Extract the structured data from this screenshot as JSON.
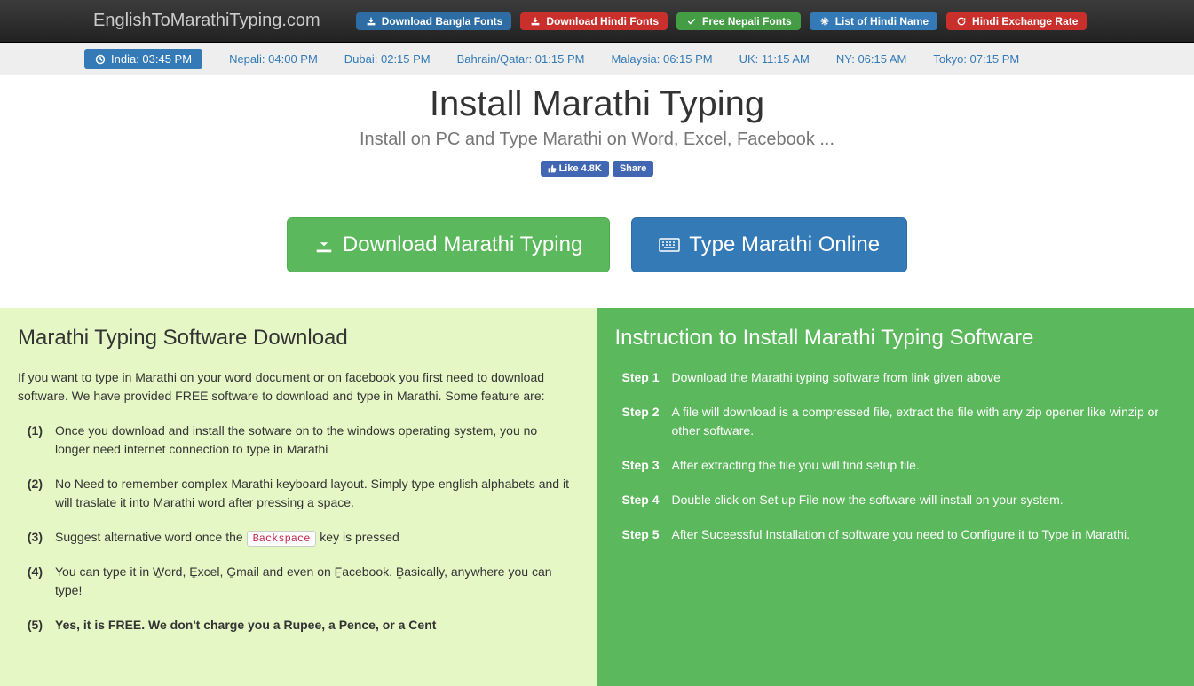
{
  "header": {
    "brand": "EnglishToMarathiTyping.com",
    "links": [
      {
        "label": "Download Bangla Fonts",
        "class": "pill-blue",
        "icon": "download"
      },
      {
        "label": "Download Hindi Fonts",
        "class": "pill-red",
        "icon": "download"
      },
      {
        "label": "Free Nepali Fonts",
        "class": "pill-green",
        "icon": "check"
      },
      {
        "label": "List of Hindi Name",
        "class": "pill-teal",
        "icon": "asterisk"
      },
      {
        "label": "Hindi Exchange Rate",
        "class": "pill-red",
        "icon": "refresh"
      }
    ]
  },
  "timebar": {
    "india": "India: 03:45 PM",
    "zones": [
      "Nepali: 04:00 PM",
      "Dubai: 02:15 PM",
      "Bahrain/Qatar: 01:15 PM",
      "Malaysia: 06:15 PM",
      "UK: 11:15 AM",
      "NY: 06:15 AM",
      "Tokyo: 07:15 PM"
    ]
  },
  "hero": {
    "title": "Install Marathi Typing",
    "subtitle": "Install on PC and Type Marathi on Word, Excel, Facebook ...",
    "like_label": "Like",
    "like_count": "4.8K",
    "share_label": "Share",
    "download_btn": "Download Marathi Typing",
    "type_btn": "Type Marathi Online"
  },
  "left": {
    "heading": "Marathi Typing Software Download",
    "intro": "If you want to type in Marathi on your word document or on facebook you first need to download software. We have provided FREE software to download and type in Marathi. Some feature are:",
    "features": [
      "Once you download and install the sotware on to the windows operating system, you no longer need internet connection to type in Marathi",
      "No Need to remember complex Marathi keyboard layout. Simply type english alphabets and it will traslate it into Marathi word after pressing a space.",
      "Suggest alternative word once the |KEY| key is pressed",
      "You can type it in W̱ord, E̱xcel, G̱mail and even on F̱acebook. Ḇasically, anywhere you can type!",
      "Yes, it is FREE. We don't charge you a Rupee, a Pence, or a Cent"
    ],
    "key_label": "Backspace"
  },
  "right": {
    "heading": "Instruction to Install Marathi Typing Software",
    "step_prefix": "Step",
    "steps": [
      "Download the Marathi typing software from link given above",
      "A file will download is a compressed file, extract the file with any zip opener like winzip or other software.",
      "After extracting the file you will find setup file.",
      "Double click on Set up File now the software will install on your system.",
      "After Suceessful Installation of software you need to Configure it to Type in Marathi."
    ]
  }
}
